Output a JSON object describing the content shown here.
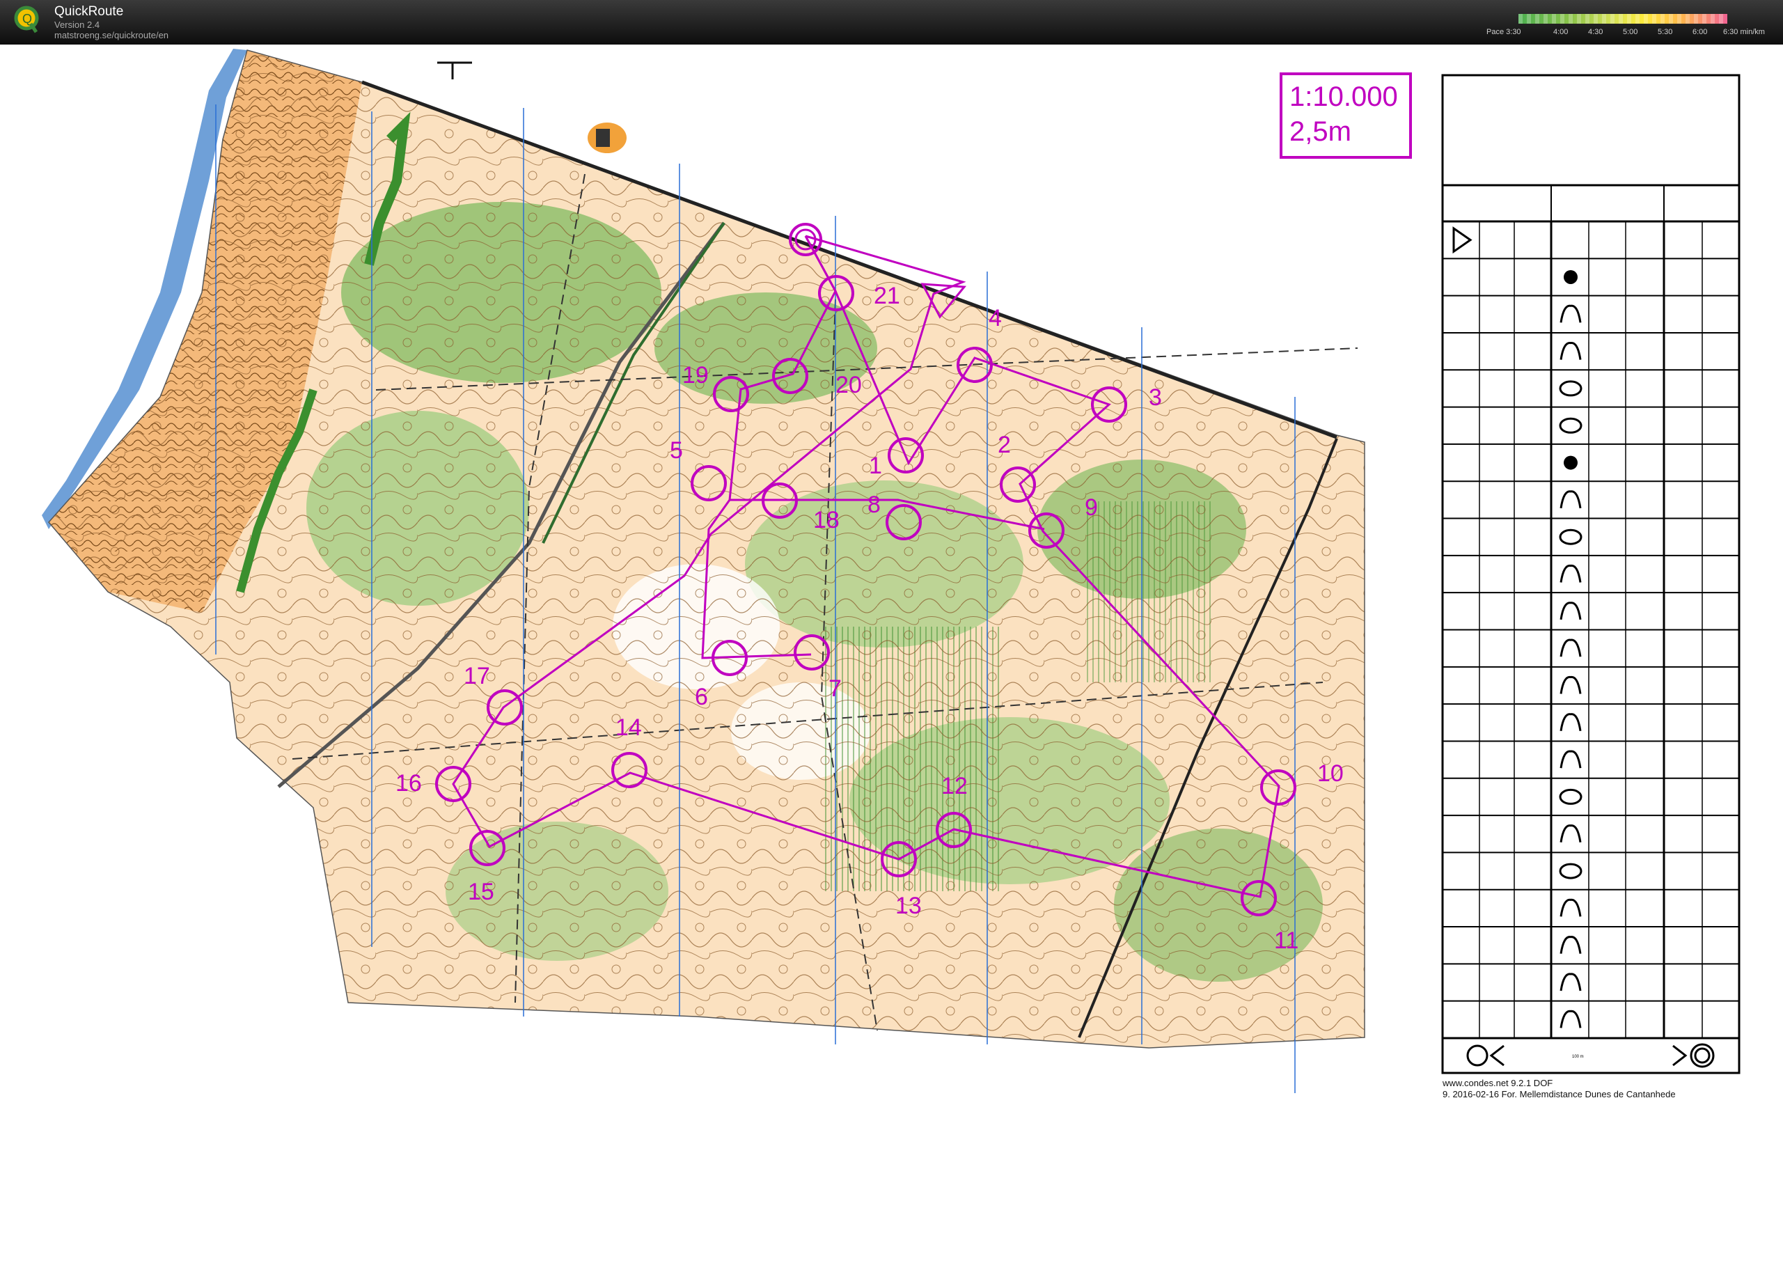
{
  "app": {
    "name": "QuickRoute",
    "version": "Version 2.4",
    "url": "matstroeng.se/quickroute/en"
  },
  "pace_legend": {
    "label": "Pace",
    "ticks": [
      "3:30",
      "4:00",
      "4:30",
      "5:00",
      "5:30",
      "6:00",
      "6:30"
    ],
    "unit": "min/km"
  },
  "map": {
    "scale_line1": "1:10.000",
    "scale_line2": "2,5m",
    "controls": [
      "1",
      "2",
      "3",
      "4",
      "5",
      "6",
      "7",
      "8",
      "9",
      "10",
      "11",
      "12",
      "13",
      "14",
      "15",
      "16",
      "17",
      "18",
      "19",
      "20",
      "21"
    ],
    "colors": {
      "course": "#c000c0",
      "open_land": "#f7c98d",
      "green": "#8fbf6c",
      "dark_green": "#3b8f2e",
      "water": "#6fa0d8",
      "north_line": "#2a6fd6"
    }
  },
  "description_sheet": {
    "rows": 21,
    "distance_label": "100 m"
  },
  "footer": {
    "line1": "www.condes.net 9.2.1 DOF",
    "line2": "9. 2016-02-16 For. Mellemdistance Dunes de Cantanhede"
  }
}
